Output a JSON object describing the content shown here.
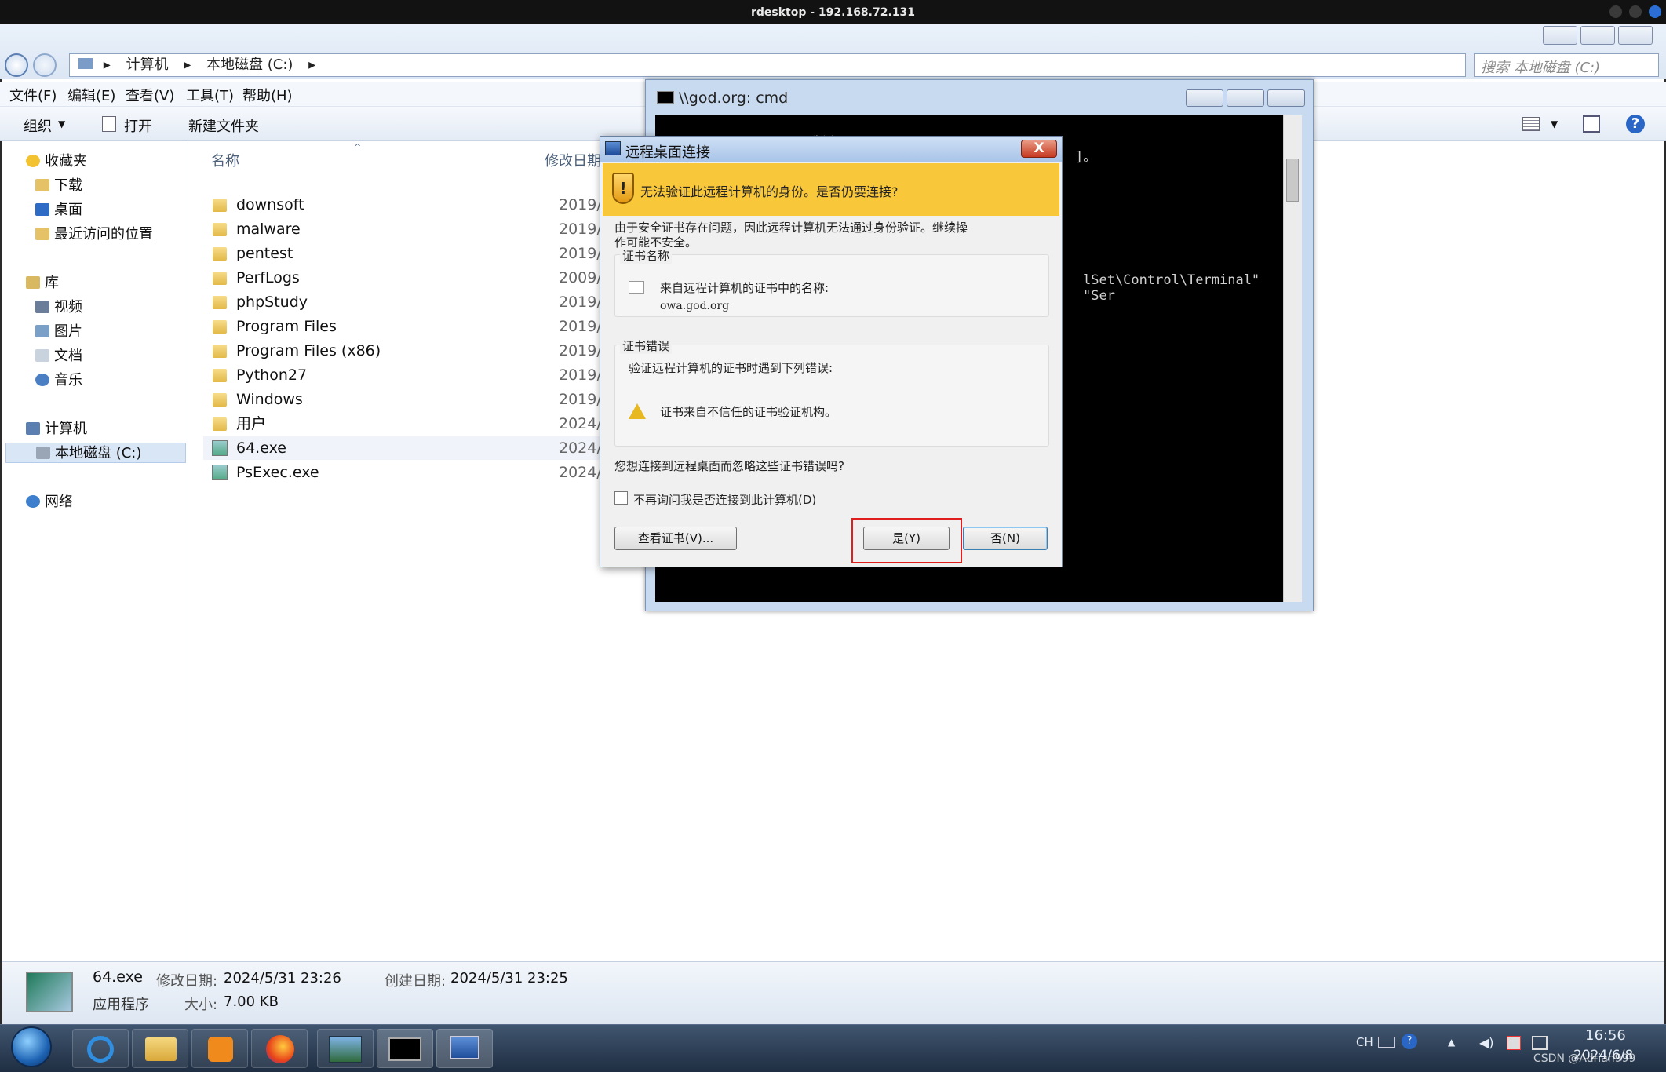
{
  "window": {
    "title": "rdesktop - 192.168.72.131"
  },
  "explorer": {
    "breadcrumb": [
      "计算机",
      "本地磁盘 (C:)"
    ],
    "search_placeholder": "搜索 本地磁盘 (C:)",
    "menu": [
      "文件(F)",
      "编辑(E)",
      "查看(V)",
      "工具(T)",
      "帮助(H)"
    ],
    "toolbar": {
      "organize": "组织",
      "open": "打开",
      "new_folder": "新建文件夹"
    },
    "sidebar": {
      "favorites": "收藏夹",
      "downloads": "下载",
      "desktop": "桌面",
      "recent": "最近访问的位置",
      "library": "库",
      "videos": "视频",
      "pictures": "图片",
      "documents": "文档",
      "music": "音乐",
      "computer": "计算机",
      "local_disk": "本地磁盘 (C:)",
      "network": "网络"
    },
    "columns": {
      "name": "名称",
      "modified": "修改日期"
    },
    "files": [
      {
        "name": "downsoft",
        "date": "2019/9/",
        "type": "folder"
      },
      {
        "name": "malware",
        "date": "2019/9/",
        "type": "folder"
      },
      {
        "name": "pentest",
        "date": "2019/9",
        "type": "folder"
      },
      {
        "name": "PerfLogs",
        "date": "2009/7",
        "type": "folder"
      },
      {
        "name": "phpStudy",
        "date": "2019/1",
        "type": "folder"
      },
      {
        "name": "Program Files",
        "date": "2019/9",
        "type": "folder"
      },
      {
        "name": "Program Files (x86)",
        "date": "2019/1",
        "type": "folder"
      },
      {
        "name": "Python27",
        "date": "2019/9",
        "type": "folder"
      },
      {
        "name": "Windows",
        "date": "2019/9",
        "type": "folder"
      },
      {
        "name": "用户",
        "date": "2024/5",
        "type": "folder"
      },
      {
        "name": "64.exe",
        "date": "2024/5",
        "type": "exe"
      },
      {
        "name": "PsExec.exe",
        "date": "2024/6",
        "type": "exe"
      }
    ],
    "status": {
      "filename": "64.exe",
      "modified_label": "修改日期:",
      "modified": "2024/5/31 23:26",
      "created_label": "创建日期:",
      "created": "2024/5/31 23:25",
      "type": "应用程序",
      "size_label": "大小:",
      "size": "7.00 KB"
    }
  },
  "cmd": {
    "title": "\\\\god.org: cmd",
    "line1": "Microsoft Windows [版本 6.1.7601]",
    "line1_tail": "]。",
    "line2": "lSet\\Control\\Terminal\" \"Ser"
  },
  "rdp_dialog": {
    "title": "远程桌面连接",
    "warning": "无法验证此远程计算机的身份。是否仍要连接?",
    "desc_line1": "由于安全证书存在问题，因此远程计算机无法通过身份验证。继续操",
    "desc_line2": "作可能不安全。",
    "cert_name_label": "证书名称",
    "cert_from": "来自远程计算机的证书中的名称:",
    "cert_host": "owa.god.org",
    "cert_error_label": "证书错误",
    "cert_error_intro": "验证远程计算机的证书时遇到下列错误:",
    "cert_error": "证书来自不信任的证书验证机构。",
    "question": "您想连接到远程桌面而忽略这些证书错误吗?",
    "dont_ask": "不再询问我是否连接到此计算机(D)",
    "view_cert": "查看证书(V)...",
    "yes": "是(Y)",
    "no": "否(N)",
    "close": "X"
  },
  "tray": {
    "lang": "CH",
    "time": "16:56",
    "date": "2024/6/8",
    "watermark": "CSDN @Adrian999"
  },
  "colors": {
    "warning_bar": "#f9c73a",
    "highlight_box": "#e01e1e",
    "taskbar": "#1f2e42"
  }
}
